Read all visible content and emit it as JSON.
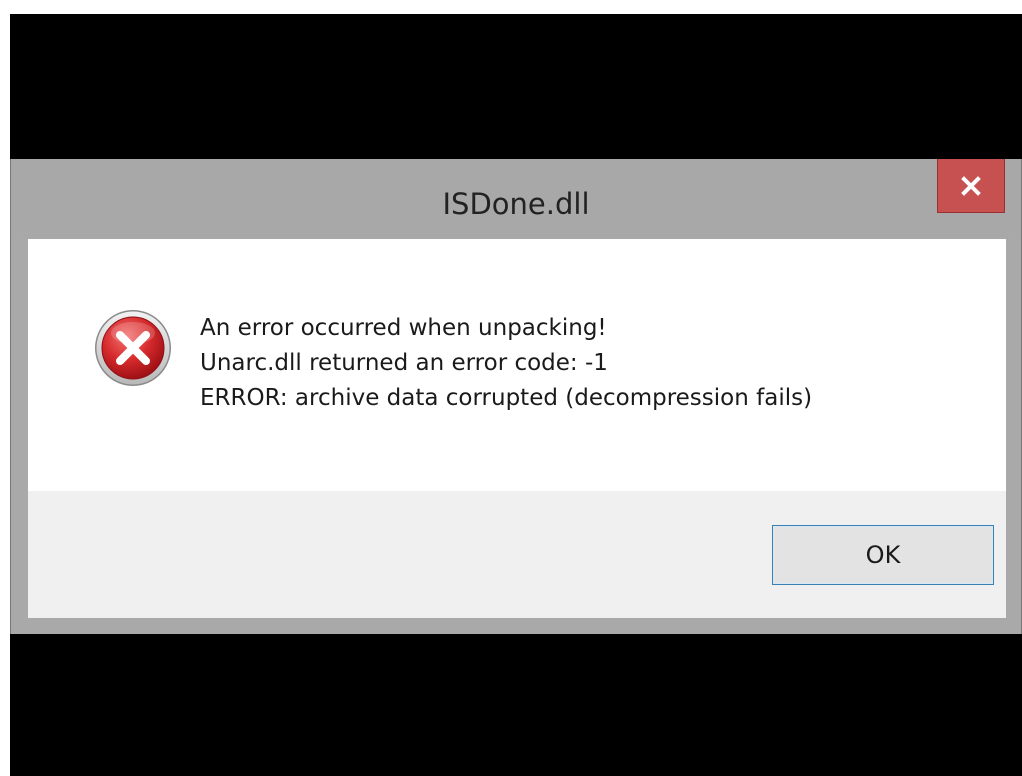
{
  "window": {
    "title": "ISDone.dll",
    "close_glyph": "x"
  },
  "message": {
    "icon": "error-icon",
    "lines": [
      "An error occurred when unpacking!",
      "Unarc.dll returned an error code: -1",
      "ERROR: archive data corrupted (decompression fails)"
    ]
  },
  "buttons": {
    "ok_label": "OK"
  },
  "colors": {
    "titlebar": "#a8a8a8",
    "close_button": "#c75050",
    "error_icon_red": "#c8171f",
    "ok_button_border": "#3c7fb1"
  }
}
